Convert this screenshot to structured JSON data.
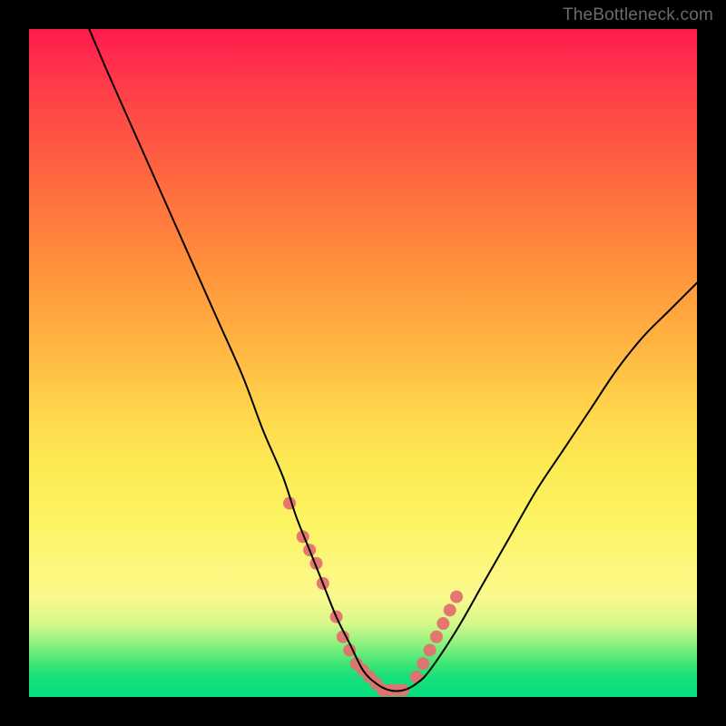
{
  "watermark": "TheBottleneck.com",
  "chart_data": {
    "type": "line",
    "title": "",
    "xlabel": "",
    "ylabel": "",
    "xlim": [
      0,
      100
    ],
    "ylim": [
      0,
      100
    ],
    "grid": false,
    "legend": false,
    "background_gradient": {
      "direction": "top_to_bottom",
      "stops": [
        {
          "pos": 0,
          "color": "#ff1a4d"
        },
        {
          "pos": 0.5,
          "color": "#ffc84a"
        },
        {
          "pos": 0.8,
          "color": "#fcf77a"
        },
        {
          "pos": 1,
          "color": "#07dd7f"
        }
      ]
    },
    "series": [
      {
        "name": "curve",
        "color": "#000000",
        "stroke_width": 2,
        "x": [
          9,
          12,
          16,
          20,
          24,
          28,
          32,
          35,
          38,
          40,
          42,
          44,
          46,
          48,
          50,
          52,
          54,
          56,
          58,
          60,
          64,
          68,
          72,
          76,
          80,
          84,
          88,
          92,
          96,
          100
        ],
        "y": [
          100,
          93,
          84,
          75,
          66,
          57,
          48,
          40,
          33,
          27,
          22,
          17,
          12,
          8,
          4,
          2,
          1,
          1,
          2,
          4,
          10,
          17,
          24,
          31,
          37,
          43,
          49,
          54,
          58,
          62
        ]
      },
      {
        "name": "markers",
        "color": "#e47070",
        "marker_radius": 7,
        "x": [
          39,
          41,
          42,
          43,
          44,
          46,
          47,
          48,
          49,
          50,
          51,
          52,
          53,
          54,
          55,
          56,
          58,
          59,
          60,
          61,
          62,
          63,
          64
        ],
        "y": [
          29,
          24,
          22,
          20,
          17,
          12,
          9,
          7,
          5,
          4,
          3,
          2,
          1,
          1,
          1,
          1,
          3,
          5,
          7,
          9,
          11,
          13,
          15
        ]
      }
    ]
  }
}
